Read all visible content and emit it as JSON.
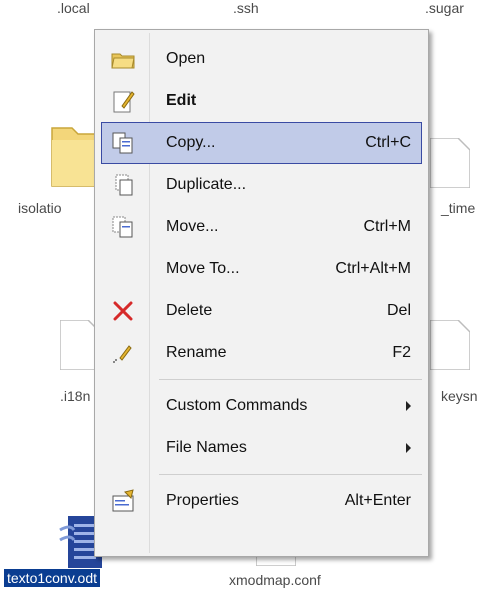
{
  "desktop": {
    "top_labels": [
      ".local",
      ".ssh",
      ".sugar"
    ],
    "mid_labels": {
      "left": "isolatio",
      "right": "_time"
    },
    "lower_labels": {
      "left": ".i18n",
      "right": "keysn"
    },
    "bottom_labels": {
      "selected": "texto1conv.odt",
      "other": "xmodmap.conf"
    }
  },
  "menu": {
    "open": "Open",
    "edit": "Edit",
    "copy": {
      "label": "Copy...",
      "shortcut": "Ctrl+C"
    },
    "duplicate": "Duplicate...",
    "move": {
      "label": "Move...",
      "shortcut": "Ctrl+M"
    },
    "move_to": {
      "label": "Move To...",
      "shortcut": "Ctrl+Alt+M"
    },
    "delete": {
      "label": "Delete",
      "shortcut": "Del"
    },
    "rename": {
      "label": "Rename",
      "shortcut": "F2"
    },
    "custom_commands": "Custom Commands",
    "file_names": "File Names",
    "properties": {
      "label": "Properties",
      "shortcut": "Alt+Enter"
    }
  },
  "colors": {
    "highlight_bg": "#c1cbe8",
    "highlight_border": "#3a4ba3",
    "selection_bg": "#0a3d91"
  }
}
